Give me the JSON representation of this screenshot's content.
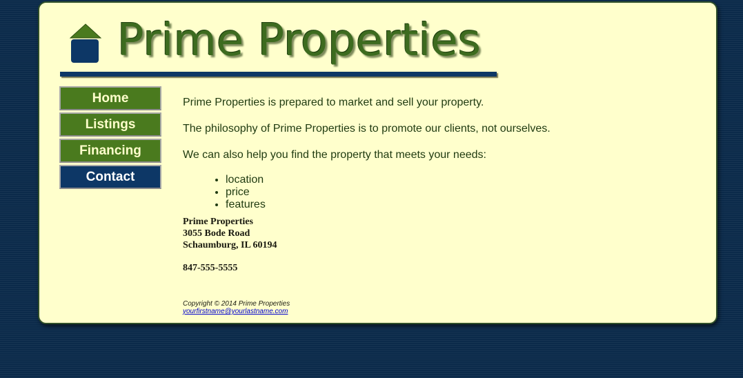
{
  "header": {
    "title": "Prime Properties",
    "logo_icon": "house-icon",
    "colors": {
      "title": "#3d6b1f",
      "rule": "#0d3766"
    }
  },
  "nav": {
    "items": [
      {
        "label": "Home",
        "active": false
      },
      {
        "label": "Listings",
        "active": false
      },
      {
        "label": "Financing",
        "active": false
      },
      {
        "label": "Contact",
        "active": true
      }
    ],
    "colors": {
      "default_bg": "#4a7a1e",
      "active_bg": "#0d3766"
    }
  },
  "main": {
    "paragraphs": [
      "Prime Properties is prepared to market and sell your property.",
      "The philosophy of Prime Properties is to promote our clients, not ourselves.",
      "We can also help you find the property that meets your needs:"
    ],
    "needs": [
      "location",
      "price",
      "features"
    ]
  },
  "address": {
    "name": "Prime Properties",
    "street": "3055 Bode Road",
    "city": "Schaumburg, IL 60194",
    "phone": "847-555-5555"
  },
  "footer": {
    "copyright": "Copyright © 2014 Prime Properties",
    "email": "yourfirstname@yourlastname.com"
  },
  "page": {
    "background": "#0b2a4a",
    "panel_background": "#ffffcc"
  }
}
